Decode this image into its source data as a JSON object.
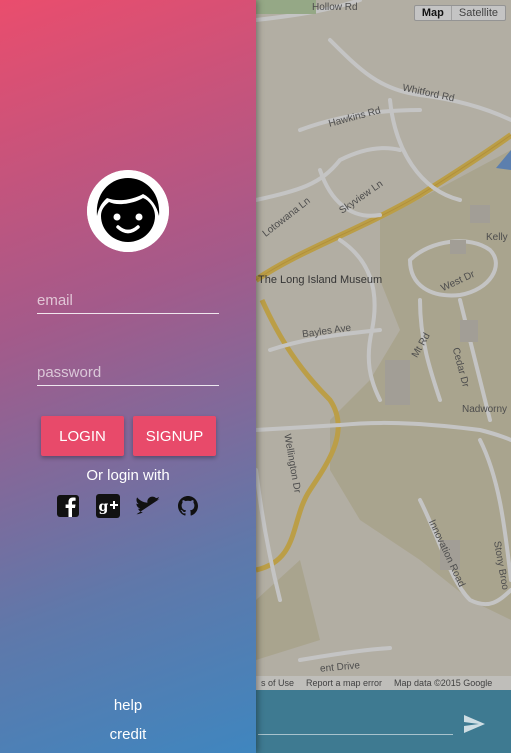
{
  "auth": {
    "email_placeholder": "email",
    "password_placeholder": "password",
    "login_label": "LOGIN",
    "signup_label": "SIGNUP",
    "or_login_with": "Or login with",
    "social": [
      "facebook-icon",
      "google-plus-icon",
      "twitter-icon",
      "github-icon"
    ]
  },
  "footer": {
    "help": "help",
    "credit": "credit"
  },
  "map": {
    "type_toggle": [
      "Map",
      "Satellite"
    ],
    "labels": {
      "hollow_rd": "Hollow Rd",
      "whitford_rd": "Whitford Rd",
      "hawkins_rd": "Hawkins Rd",
      "skyview_ln": "Skyview Ln",
      "lotowana_ln": "Lotowana Ln",
      "kelly": "Kelly",
      "museum": "The Long Island Museum",
      "west_dr": "West Dr",
      "bayles_ave": "Bayles Ave",
      "mt_rd": "Mt Rd",
      "cedar_dr": "Cedar Dr",
      "nadworny": "Nadworny",
      "wellington_dr": "Wellington Dr",
      "innovation_road": "Innovation Road",
      "stony_brook": "Stony Broo",
      "ent_drive": "ent Drive"
    },
    "attribution": [
      "s of Use",
      "Report a map error",
      "Map data ©2015 Google"
    ]
  },
  "colors": {
    "accent": "#e84a6a",
    "gradient_top": "#ea4d6d",
    "gradient_bottom": "#3f86bf",
    "bar": "#3e7a91"
  }
}
